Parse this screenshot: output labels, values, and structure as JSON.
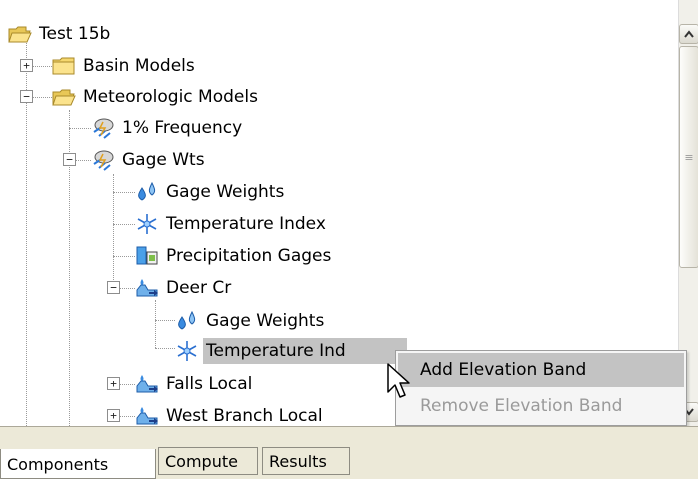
{
  "tree": {
    "root": "Test 15b",
    "basin_models": "Basin Models",
    "meteorologic_models": "Meteorologic Models",
    "frequency_model": "1% Frequency",
    "gage_wts": "Gage Wts",
    "gage_weights": "Gage Weights",
    "temperature_index": "Temperature Index",
    "precipitation_gages": "Precipitation Gages",
    "deer_cr": "Deer Cr",
    "deer_gage_weights": "Gage Weights",
    "deer_temperature_index": "Temperature Ind",
    "falls_local": "Falls Local",
    "west_branch_local": "West Branch Local"
  },
  "context_menu": {
    "add_elevation_band": "Add Elevation Band",
    "remove_elevation_band": "Remove Elevation Band"
  },
  "tabs": {
    "components": "Components",
    "compute": "Compute",
    "results": "Results"
  },
  "icons": {
    "folder": "folder-icon",
    "open_folder": "open-folder-icon",
    "met_model": "meteorologic-model-icon",
    "water_drops": "water-drops-icon",
    "snowflake": "snowflake-icon",
    "precip_gage": "precipitation-gage-icon",
    "subbasin": "subbasin-icon"
  },
  "colors": {
    "selection": "#c3c3c3",
    "folder": "#f5d76e",
    "tab_bar": "#ece9d8",
    "disabled_text": "#9a9a9a"
  }
}
